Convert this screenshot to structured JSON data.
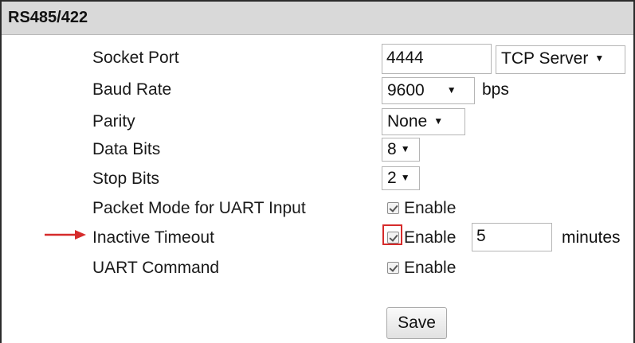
{
  "panel": {
    "title": "RS485/422"
  },
  "fields": {
    "socket_port": {
      "label": "Socket Port",
      "value": "4444",
      "mode": "TCP Server"
    },
    "baud_rate": {
      "label": "Baud Rate",
      "value": "9600",
      "unit": "bps"
    },
    "parity": {
      "label": "Parity",
      "value": "None"
    },
    "data_bits": {
      "label": "Data Bits",
      "value": "8"
    },
    "stop_bits": {
      "label": "Stop Bits",
      "value": "2"
    },
    "packet_mode": {
      "label": "Packet Mode for UART Input",
      "checkbox_label": "Enable",
      "checked": true
    },
    "inactive_timeout": {
      "label": "Inactive Timeout",
      "checkbox_label": "Enable",
      "checked": true,
      "value": "5",
      "unit": "minutes"
    },
    "uart_command": {
      "label": "UART Command",
      "checkbox_label": "Enable",
      "checked": true
    }
  },
  "actions": {
    "save_label": "Save"
  },
  "annotations": {
    "highlight_color": "#d62b2b",
    "arrow_color": "#d62b2b"
  }
}
